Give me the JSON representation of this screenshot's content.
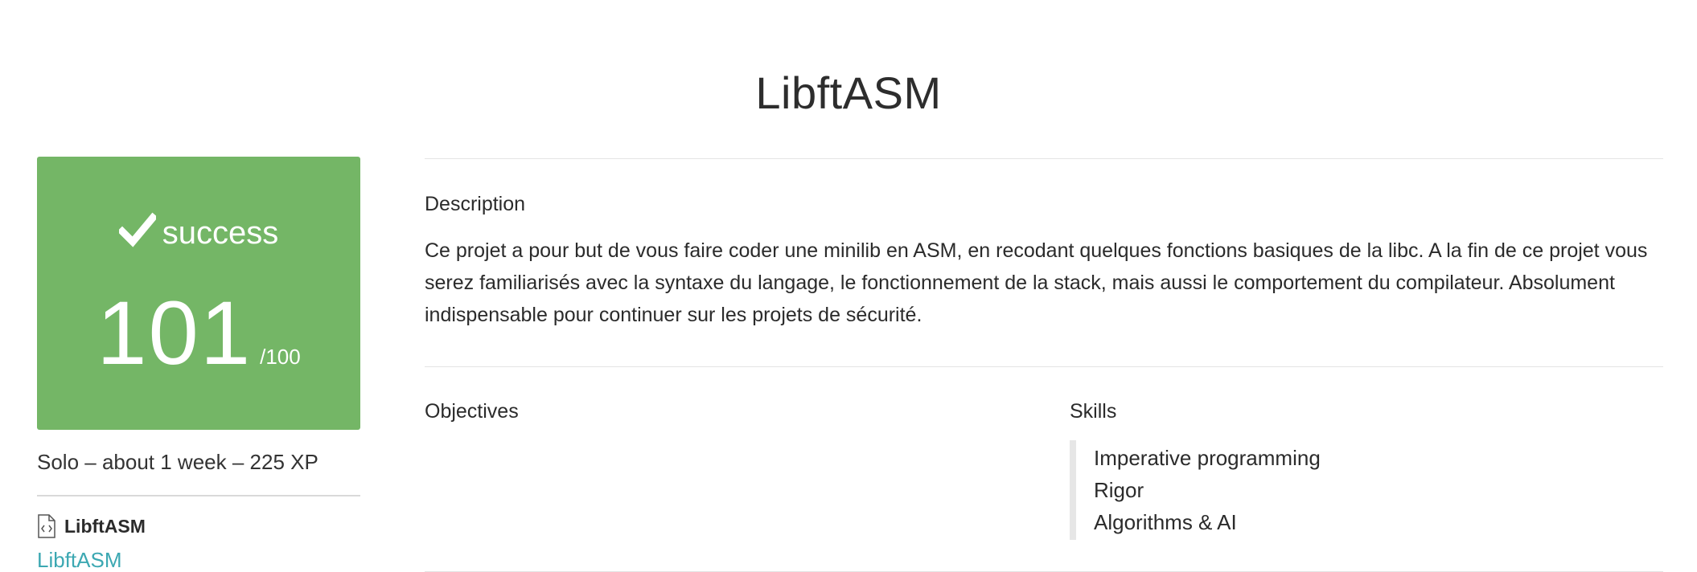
{
  "project": {
    "title": "LibftASM"
  },
  "score_card": {
    "status": "success",
    "score": "101",
    "max_score": "/100",
    "icon": "check-icon",
    "color": "#74b666"
  },
  "meta": {
    "info": "Solo – about 1 week – 225 XP"
  },
  "attachment": {
    "file_name": "LibftASM",
    "link_label": "LibftASM",
    "icon": "code-file-icon",
    "link_color": "#3ca8b2"
  },
  "description": {
    "heading": "Description",
    "text": "Ce projet a pour but de vous faire coder une minilib en ASM, en recodant quelques fonctions basiques de la libc. A la fin de ce projet vous serez familiarisés avec la syntaxe du langage, le fonctionnement de la stack, mais aussi le comportement du compilateur. Absolument indispensable pour continuer sur les projets de sécurité."
  },
  "objectives": {
    "heading": "Objectives"
  },
  "skills": {
    "heading": "Skills",
    "items": [
      "Imperative programming",
      "Rigor",
      "Algorithms & AI"
    ]
  }
}
